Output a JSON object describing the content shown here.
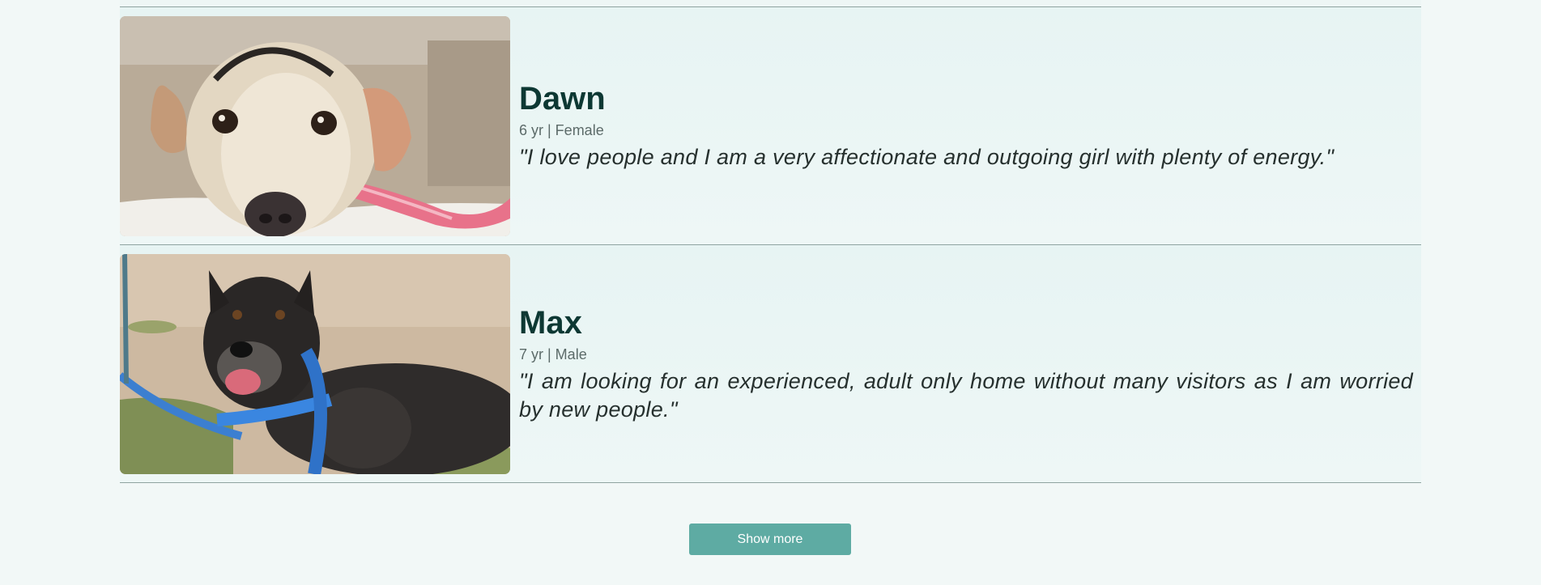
{
  "pets": [
    {
      "name": "Dawn",
      "meta": "6 yr | Female",
      "quote": "\"I love people and I am a very affectionate and outgoing girl with plenty of energy.\""
    },
    {
      "name": "Max",
      "meta": "7 yr | Male",
      "quote": "\"I am looking for an experienced, adult only home without many visitors as I am worried by new people.\""
    }
  ],
  "footer": {
    "show_more_label": "Show more"
  },
  "colors": {
    "page_background": "#f2f8f7",
    "card_background": "#e7f4f3",
    "name_text": "#0d3833",
    "button": "#5eaba3"
  }
}
